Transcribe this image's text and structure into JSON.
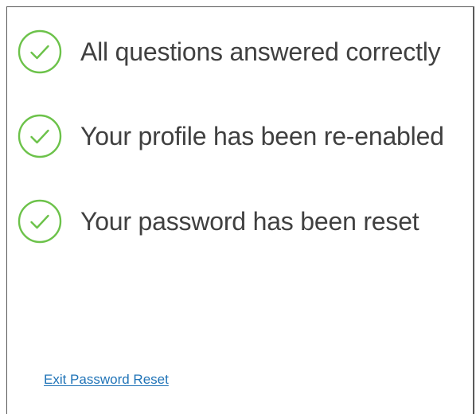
{
  "colors": {
    "check_green": "#6cc24a",
    "text": "#404040",
    "link": "#1f73b7",
    "border": "#5a5a5a"
  },
  "status_items": [
    {
      "icon": "check-circle-icon",
      "text": "All questions answered correctly"
    },
    {
      "icon": "check-circle-icon",
      "text": "Your profile has been re-enabled"
    },
    {
      "icon": "check-circle-icon",
      "text": "Your password has been reset"
    }
  ],
  "footer": {
    "exit_link_label": "Exit Password Reset"
  }
}
